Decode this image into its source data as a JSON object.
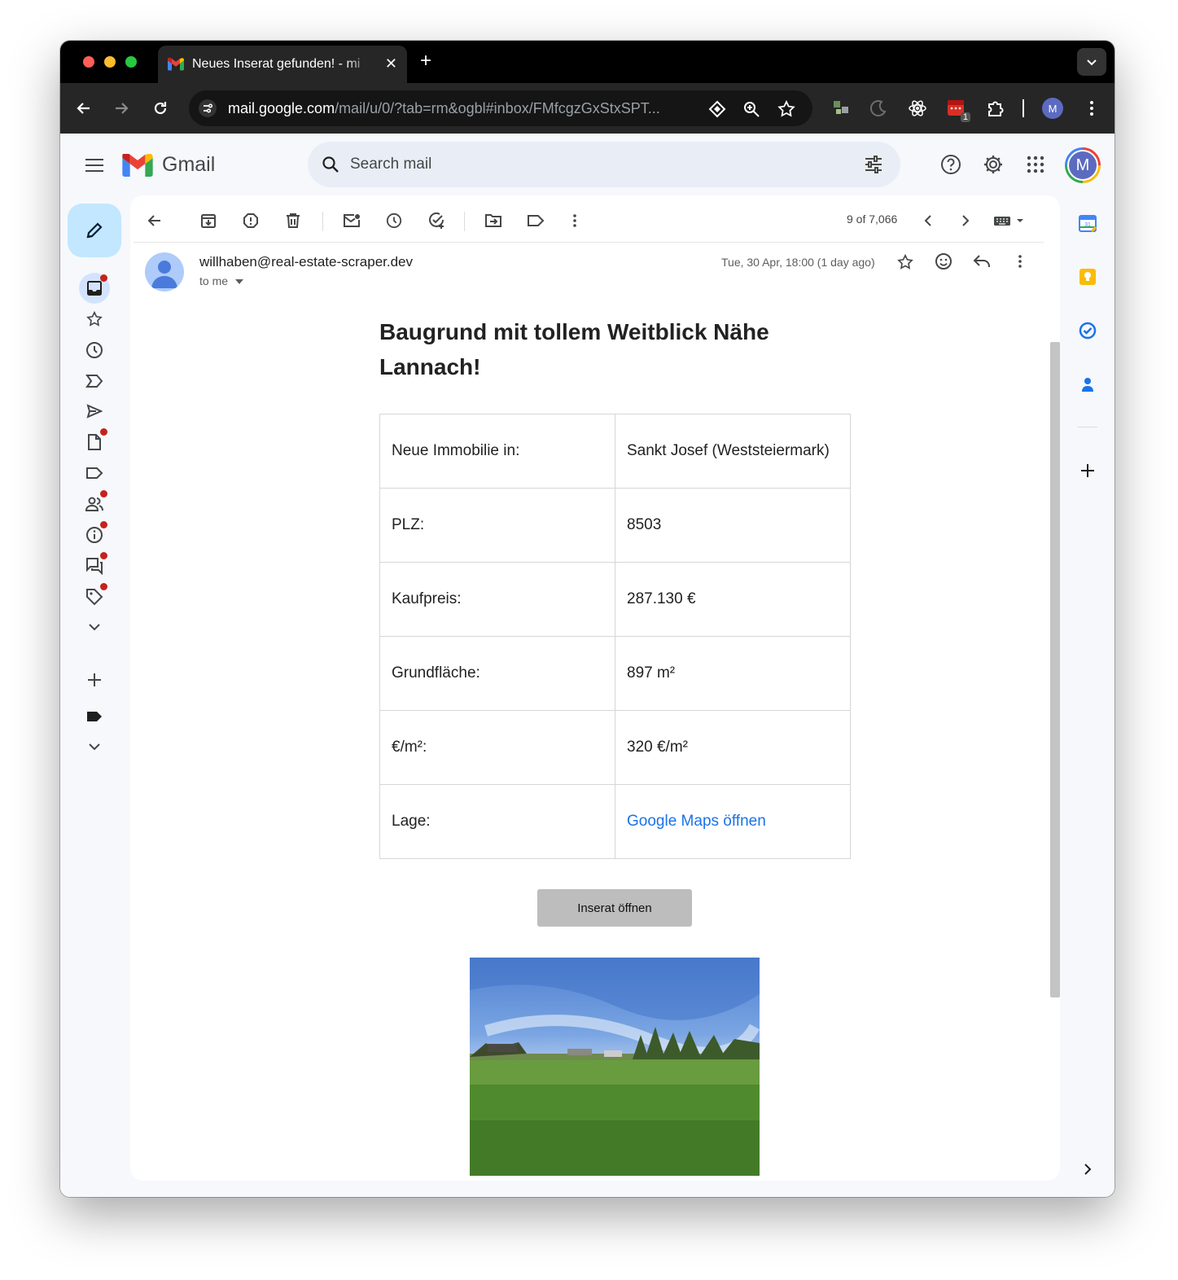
{
  "browser": {
    "tab_title": "Neues Inserat gefunden! - mi",
    "url_domain": "mail.google.com",
    "url_path": "/mail/u/0/?tab=rm&ogbl#inbox/FMfcgzGxStxSPT...",
    "extension_badge": "1",
    "profile_initial": "M"
  },
  "gmail": {
    "logo_text": "Gmail",
    "search_placeholder": "Search mail",
    "account_initial": "M"
  },
  "message_toolbar": {
    "count": "9 of 7,066"
  },
  "email": {
    "sender": "willhaben@real-estate-scraper.dev",
    "recipient": "to me",
    "date": "Tue, 30 Apr, 18:00 (1 day ago)",
    "heading": "Baugrund mit tollem Weitblick Nähe Lannach!",
    "table": [
      {
        "label": "Neue Immobilie in:",
        "value": "Sankt Josef (Weststeiermark)"
      },
      {
        "label": "PLZ:",
        "value": "8503"
      },
      {
        "label": "Kaufpreis:",
        "value": "287.130 €"
      },
      {
        "label": "Grundfläche:",
        "value": "897 m²"
      },
      {
        "label": "€/m²:",
        "value": "320 €/m²"
      },
      {
        "label": "Lage:",
        "value": "Google Maps öffnen"
      }
    ],
    "button_label": "Inserat öffnen"
  },
  "colors": {
    "compose_bg": "#c2e7ff",
    "link": "#1a73e8",
    "badge_red": "#c5221f",
    "search_bg": "#e9eef6"
  }
}
